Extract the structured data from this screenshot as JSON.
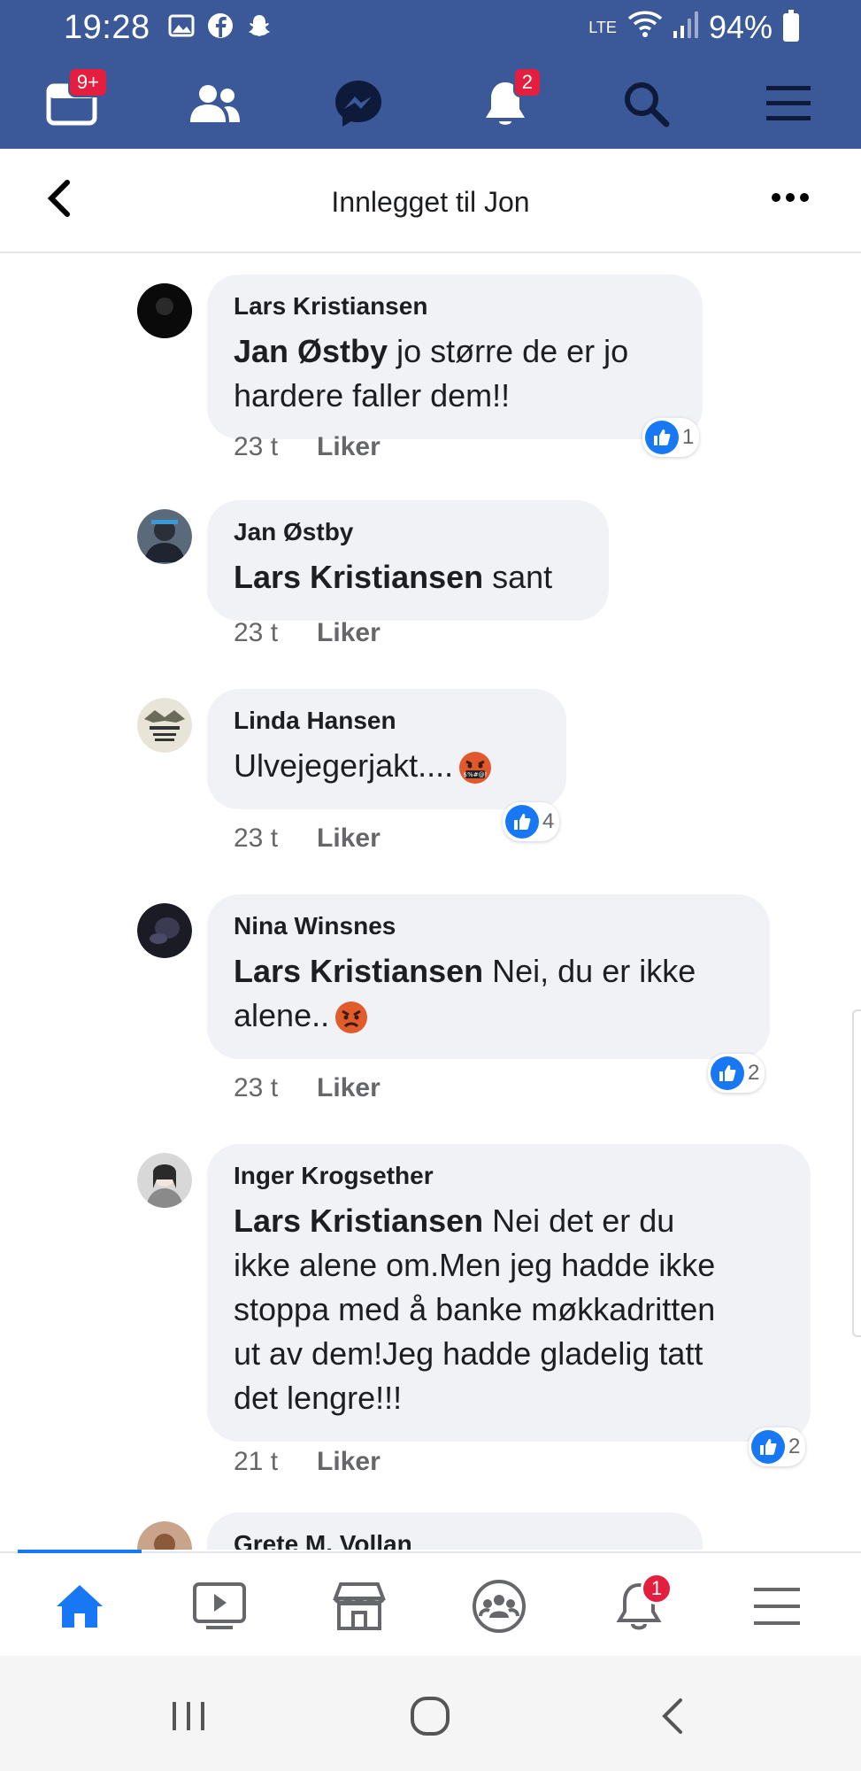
{
  "status_bar": {
    "time": "19:28",
    "lte_label": "LTE",
    "battery": "94%"
  },
  "top_nav": {
    "feed_badge": "9+",
    "notifications_badge": "2"
  },
  "header": {
    "title": "Innlegget til Jon"
  },
  "comments": [
    {
      "author": "Lars Kristiansen",
      "mention": "Jan Østby",
      "text_line1": " jo større de er jo",
      "text_line2": "hardere faller dem!!",
      "time": "23 t",
      "like_label": "Liker",
      "reaction_count": "1"
    },
    {
      "author": "Jan Østby",
      "mention": "Lars Kristiansen",
      "text_line1": " sant",
      "time": "23 t",
      "like_label": "Liker"
    },
    {
      "author": "Linda Hansen",
      "text_line1": "Ulvejegerjakt....",
      "time": "23 t",
      "like_label": "Liker",
      "reaction_count": "4"
    },
    {
      "author": "Nina Winsnes",
      "mention": "Lars Kristiansen",
      "text_line1": " Nei, du er ikke",
      "text_line2": "alene..",
      "time": "23 t",
      "like_label": "Liker",
      "reaction_count": "2"
    },
    {
      "author": "Inger Krogsether",
      "mention": "Lars Kristiansen",
      "text_line1": " Nei det er du",
      "text_line2": "ikke alene om.Men jeg hadde ikke",
      "text_line3": "stoppa med å banke møkkadritten",
      "text_line4": "ut av dem!Jeg hadde gladelig tatt",
      "text_line5": "det lengre!!!",
      "time": "21 t",
      "like_label": "Liker",
      "reaction_count": "2"
    },
    {
      "author": "Grete M. Vollan"
    }
  ],
  "tab_bar": {
    "notifications_badge": "1"
  },
  "colors": {
    "fb_blue": "#3b5998",
    "like_blue": "#1877f2",
    "badge_red": "#e41e3f",
    "bubble_gray": "#f0f2f5"
  }
}
